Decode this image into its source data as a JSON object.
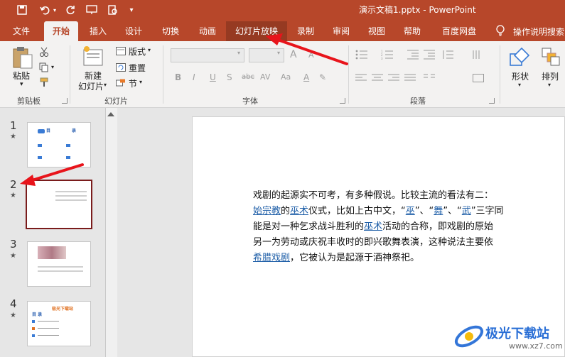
{
  "titlebar": {
    "doc_title": "演示文稿1.pptx  -  PowerPoint"
  },
  "quick_access": [
    "save-icon",
    "undo-icon",
    "redo-icon",
    "present-icon",
    "preview-icon",
    "customize-icon"
  ],
  "tabs": [
    {
      "label": "文件"
    },
    {
      "label": "开始"
    },
    {
      "label": "插入"
    },
    {
      "label": "设计"
    },
    {
      "label": "切换"
    },
    {
      "label": "动画"
    },
    {
      "label": "幻灯片放映"
    },
    {
      "label": "录制"
    },
    {
      "label": "审阅"
    },
    {
      "label": "视图"
    },
    {
      "label": "帮助"
    },
    {
      "label": "百度网盘"
    }
  ],
  "tell_me": "操作说明搜索",
  "ribbon": {
    "clipboard": {
      "paste": "粘贴",
      "label": "剪贴板"
    },
    "slides": {
      "new_slide_line1": "新建",
      "new_slide_line2": "幻灯片",
      "layout": "版式",
      "reset": "重置",
      "section": "节",
      "label": "幻灯片"
    },
    "font": {
      "label": "字体",
      "bold": "B",
      "italic": "I",
      "underline": "U",
      "strike": "S",
      "abc": "abc",
      "spacing": "AV",
      "case": "Aa",
      "size_up": "A",
      "size_down": "A",
      "font_color": "A"
    },
    "paragraph": {
      "label": "段落"
    },
    "drawing": {
      "shapes": "形状",
      "arrange": "排列"
    }
  },
  "thumbnails": [
    {
      "number": "1",
      "title_a": "目",
      "title_b": "录"
    },
    {
      "number": "2"
    },
    {
      "number": "3"
    },
    {
      "number": "4",
      "title": "极光下载站",
      "sub": "目 录"
    }
  ],
  "slide_text": {
    "line1": "戏剧的起源实不可考，有多种假说。比较主流的看法有二：",
    "line2_link1": "始宗教",
    "line2_a": "的",
    "line2_link2": "巫术",
    "line2_b": "仪式，比如上古中文，“",
    "line2_link3": "巫",
    "line2_c": "”、“",
    "line2_link4": "舞",
    "line2_d": "”、“",
    "line2_link5": "武",
    "line2_e": "”三字同",
    "line3_a": "能是对一种乞求战斗胜利的",
    "line3_link": "巫术",
    "line3_b": "活动的合称，即戏剧的原始",
    "line4": "另一为劳动或庆祝丰收时的即兴歌舞表演，这种说法主要依",
    "line5_link": "希腊戏剧",
    "line5_b": "，它被认为是起源于酒神祭祀。"
  },
  "watermark": {
    "text1": "极光下载站",
    "text2": "www.xz7.com"
  },
  "colors": {
    "accent": "#b7472a",
    "link": "#1f5fa8",
    "annotation": "#e8141b",
    "selected_thumb": "#7a1c1c"
  }
}
